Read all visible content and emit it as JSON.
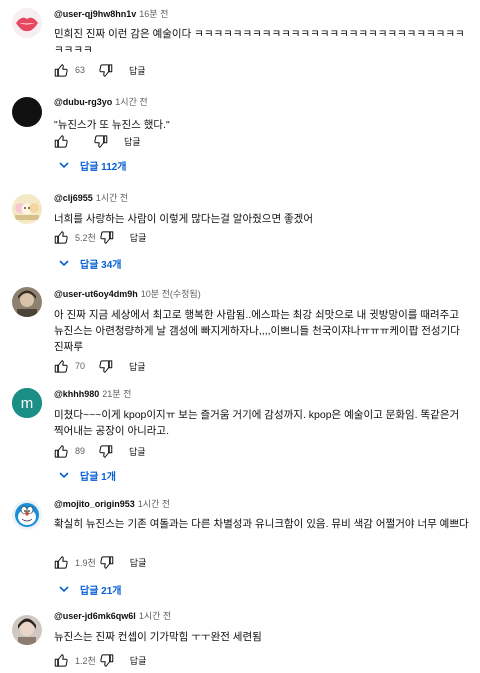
{
  "comments": [
    {
      "author": "@user-qj9hw8hn1v",
      "time": "16분 전",
      "text": "민희진 진짜 이런 감은 예술이다 ㅋㅋㅋㅋㅋㅋㅋㅋㅋㅋㅋㅋㅋㅋㅋㅋㅋㅋㅋㅋㅋㅋㅋㅋㅋㅋㅋㅋㅋㅋㅋㅋ",
      "likes": "63",
      "reply_label": "답글",
      "avatar": "lips-avatar",
      "replies": ""
    },
    {
      "author": "@dubu-rg3yo",
      "time": "1시간 전",
      "text": "\"뉴진스가 또 뉴진스 했다.\"",
      "likes": "",
      "reply_label": "답글",
      "avatar": "black-avatar",
      "replies": "답글 112개"
    },
    {
      "author": "@clj6955",
      "time": "1시간 전",
      "text": "너희를 사랑하는 사람이 이렇게 많다는걸 알아줬으면 좋겠어",
      "likes": "5.2천",
      "reply_label": "답글",
      "avatar": "cartoon-avatar",
      "replies": "답글 34개"
    },
    {
      "author": "@user-ut6oy4dm9h",
      "time": "10분 전(수정됨)",
      "text": "아 진짜 지금 세상에서 최고로 행복한 사람됨..에스파는 최강 쇠맛으로 내 귓방망이를 때려주고 뉴진스는 아련청량하게 날 갬성에 빠지게하자나,,,,이쁘니들 천국이쟈나ㅠㅠㅠ케이팝 전성기다 진짜루",
      "likes": "70",
      "reply_label": "답글",
      "avatar": "photo-avatar",
      "replies": ""
    },
    {
      "author": "@khhh980",
      "time": "21분 전",
      "text": "미쳤다~~~이게 kpop이지ㅠ 보는 즐거움 거기에 감성까지. kpop은 예술이고 문화임. 똑같은거 찍어내는 공장이 아니라고.",
      "likes": "89",
      "reply_label": "답글",
      "avatar": "letter-avatar",
      "avatar_letter": "m",
      "replies": "답글 1개"
    },
    {
      "author": "@mojito_origin953",
      "time": "1시간 전",
      "text": "확실히 뉴진스는 기존 여돌과는 다른 차별성과 유니크함이 있음. 뮤비 색감 어쩔거야 너무 예쁘다",
      "likes": "1.9천",
      "reply_label": "답글",
      "avatar": "doraemon-avatar",
      "replies": "답글 21개"
    },
    {
      "author": "@user-jd6mk6qw6l",
      "time": "1시간 전",
      "text": "뉴진스는 진짜 컨셉이 기가막힘 ㅜㅜ완전 세련됨",
      "likes": "1.2천",
      "reply_label": "답글",
      "avatar": "photo-avatar-2",
      "replies": ""
    }
  ],
  "colors": {
    "link": "#065fd4",
    "muted": "#606060",
    "letter_avatar_bg": "#1b8e86"
  }
}
